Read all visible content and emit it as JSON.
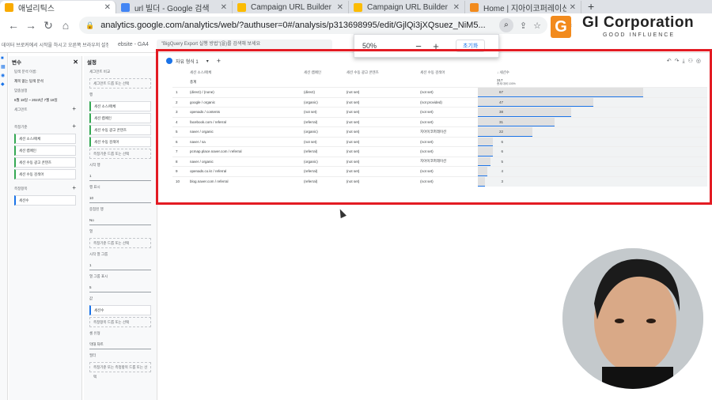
{
  "browser": {
    "tabs": [
      {
        "label": "애널리틱스",
        "icon_color": "#f9ab00",
        "active": true
      },
      {
        "label": "url 빌더 - Google 검색",
        "icon_color": "#4285f4",
        "active": false
      },
      {
        "label": "Campaign URL Builder",
        "icon_color": "#fbbc04",
        "active": false
      },
      {
        "label": "Campaign URL Builder",
        "icon_color": "#fbbc04",
        "active": false
      },
      {
        "label": "Home | 지아이코퍼레이션",
        "icon_color": "#f28b1d",
        "active": false
      }
    ],
    "new_tab": "+",
    "url": "analytics.google.com/analytics/web/?authuser=0#/analysis/p313698995/edit/GjlQi3jXQsuez_NiM5...",
    "zoom_icon": "zoom-icon"
  },
  "bookmarks": {
    "text1": "데이터 브로커에서 시작을 하시고 오른쪽 브라우저 설정",
    "text2": "ebsite - GA4",
    "search": "\"BigQuery Export 실행 방법\"(을)를 검색해 보세요"
  },
  "zoom_popup": {
    "percent": "50%",
    "minus": "−",
    "plus": "+",
    "reset": "초기화"
  },
  "logo": {
    "mark": "G",
    "name": "GI Corporation",
    "tagline": "GOOD INFLUENCE"
  },
  "variables_panel": {
    "title": "변수",
    "name_label": "탐색 분석 이름:",
    "name_value": "제목 없는 탐색 분석",
    "date_label": "맞춤설정",
    "date_value": "6월 18일 ~ 2023년 7월 18일",
    "segments_label": "세그먼트",
    "dimensions_label": "측정기준",
    "dimensions": [
      "세션 소스/매체",
      "세션 캠페인",
      "세션 수동 광고 콘텐츠",
      "세션 수동 검색어"
    ],
    "metrics_label": "측정항목",
    "metrics": [
      "세션수"
    ]
  },
  "settings_panel": {
    "title": "설정",
    "technique": "세그먼트 비교",
    "drop_segment": "세그먼트 드롭 또는 선택",
    "rows_label": "행",
    "rows": [
      "세션 소스/매체",
      "세션 캠페인",
      "세션 수동 광고 콘텐츠",
      "세션 수동 검색어"
    ],
    "drop_dim": "측정기준 드롭 또는 선택",
    "start_row_label": "시작 행",
    "start_row": "1",
    "show_rows_label": "행 표시",
    "show_rows": "10",
    "nested_label": "중첩된 행",
    "nested": "No",
    "cols_label": "열",
    "drop_col": "측정기준 드롭 또는 선택",
    "col_start_label": "시작 열 그룹",
    "col_start": "1",
    "col_groups_label": "열 그룹 표시",
    "col_groups": "5",
    "values_label": "값",
    "values": [
      "세션수"
    ],
    "drop_metric": "측정항목 드롭 또는 선택",
    "cell_type_label": "셀 유형",
    "cell_type": "막대 차트",
    "filters_label": "필터",
    "drop_filter": "측정기준 또는 측정항목 드롭 또는 선택"
  },
  "report": {
    "tab_label": "자유 형식 1",
    "headers": [
      "세션 소스/매체",
      "세션 캠페인",
      "세션 수동 광고 콘텐츠",
      "세션 수동 검색어",
      "↓ 세션수"
    ],
    "total_label": "총계",
    "total_value": "317",
    "total_pct": "총계 대비 100%",
    "rows": [
      {
        "n": "1",
        "source": "(direct) / (none)",
        "campaign": "(direct)",
        "content": "(not set)",
        "term": "(not set)",
        "sessions": 67
      },
      {
        "n": "2",
        "source": "google / organic",
        "campaign": "(organic)",
        "content": "(not set)",
        "term": "(not provided)",
        "sessions": 47
      },
      {
        "n": "3",
        "source": "openads / contents",
        "campaign": "(not set)",
        "content": "(not set)",
        "term": "(not set)",
        "sessions": 38
      },
      {
        "n": "4",
        "source": "facebook.com / referral",
        "campaign": "(referral)",
        "content": "(not set)",
        "term": "(not set)",
        "sessions": 31
      },
      {
        "n": "5",
        "source": "naver / organic",
        "campaign": "(organic)",
        "content": "(not set)",
        "term": "지아이코퍼레이션",
        "sessions": 22
      },
      {
        "n": "6",
        "source": "naver / sa",
        "campaign": "(not set)",
        "content": "(not set)",
        "term": "(not set)",
        "sessions": 6
      },
      {
        "n": "7",
        "source": "pcmap.place.naver.com / referral",
        "campaign": "(referral)",
        "content": "(not set)",
        "term": "(not set)",
        "sessions": 6
      },
      {
        "n": "8",
        "source": "naver / organic",
        "campaign": "(organic)",
        "content": "(not set)",
        "term": "지아이코퍼레이션",
        "sessions": 5
      },
      {
        "n": "9",
        "source": "openads.co.kr / referral",
        "campaign": "(referral)",
        "content": "(not set)",
        "term": "(not set)",
        "sessions": 4
      },
      {
        "n": "10",
        "source": "blog.naver.com / referral",
        "campaign": "(referral)",
        "content": "(not set)",
        "term": "(not set)",
        "sessions": 3
      }
    ]
  },
  "colors": {
    "accent": "#1a73e8",
    "highlight": "#e31b23",
    "brand": "#f28b1d"
  }
}
